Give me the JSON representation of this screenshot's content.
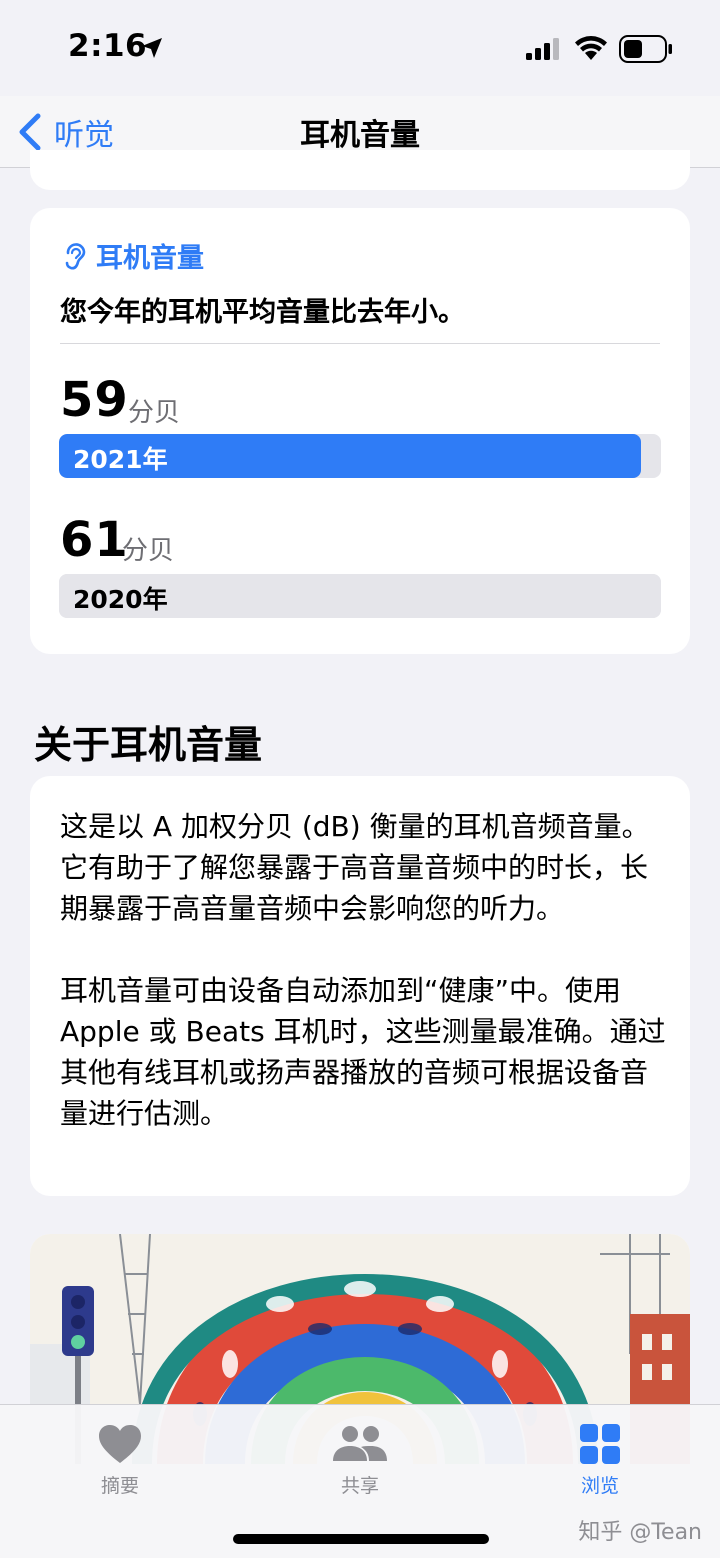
{
  "status_bar": {
    "time": "2:16"
  },
  "nav": {
    "back_label": "听觉",
    "title": "耳机音量"
  },
  "volume_card": {
    "header_title": "耳机音量",
    "headline": "您今年的耳机平均音量比去年小。",
    "metrics": [
      {
        "value": "59",
        "unit": "分贝",
        "year_label": "2021年",
        "bar_color": "#2f7cf6",
        "label_color": "#ffffff",
        "fill_fraction": 0.967
      },
      {
        "value": "61",
        "unit": "分贝",
        "year_label": "2020年",
        "bar_color": "#e5e5ea",
        "label_color": "#000000",
        "fill_fraction": 1.0
      }
    ]
  },
  "about": {
    "section_title": "关于耳机音量",
    "text": "这是以 A 加权分贝 (dB) 衡量的耳机音频音量。它有助于了解您暴露于高音量音频中的时长，长期暴露于高音量音频中会影响您的听力。\n\n耳机音量可由设备自动添加到“健康”中。使用 Apple 或 Beats 耳机时，这些测量最准确。通过其他有线耳机或扬声器播放的音频可根据设备音量进行估测。"
  },
  "tab_bar": {
    "tabs": [
      {
        "label": "摘要",
        "icon": "heart-icon",
        "active": false
      },
      {
        "label": "共享",
        "icon": "people-icon",
        "active": false
      },
      {
        "label": "浏览",
        "icon": "grid-icon",
        "active": true
      }
    ],
    "inactive_color": "#8e8e93",
    "active_color": "#2f7cf6"
  },
  "watermark": "知乎 @Tean"
}
